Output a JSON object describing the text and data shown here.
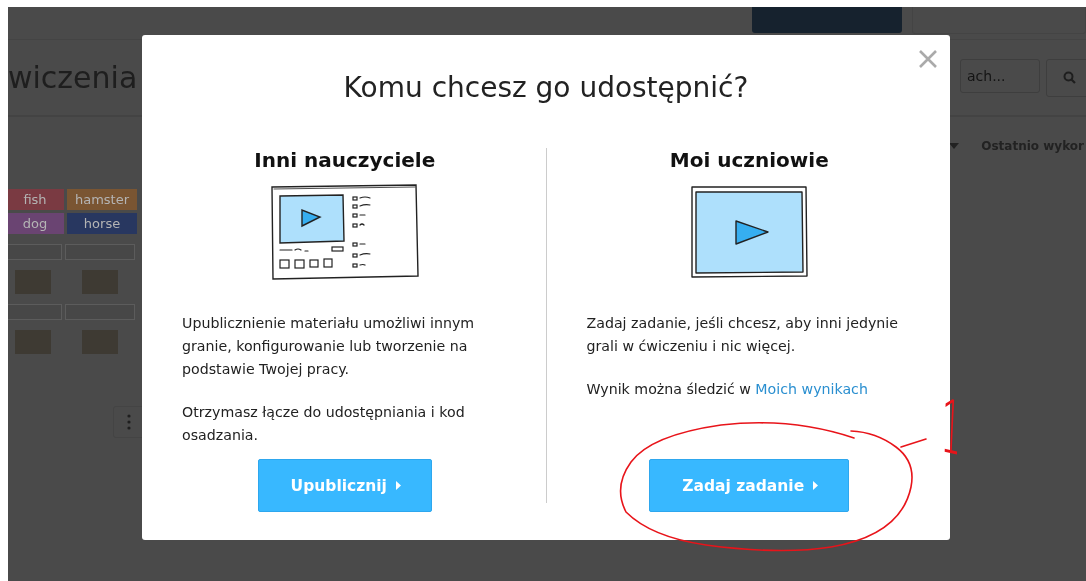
{
  "background": {
    "title": "wiczenia",
    "search": {
      "placeholder": "ach..."
    },
    "sort_label": "Ostatnio wykor",
    "tags": [
      {
        "label": "fish",
        "color": "#7a3a42"
      },
      {
        "label": "hamster",
        "color": "#7a5532"
      },
      {
        "label": "dog",
        "color": "#6a4472"
      },
      {
        "label": "horse",
        "color": "#283760"
      }
    ]
  },
  "dialog": {
    "title": "Komu chcesz go udostępnić?",
    "options": [
      {
        "kind": "publish",
        "heading": "Inni nauczyciele",
        "paragraphs": [
          {
            "text": "Upublicznienie materiału umożliwi innym granie, konfigurowanie lub tworzenie na podstawie Twojej pracy."
          },
          {
            "text": "Otrzymasz łącze do udostępniania i kod osadzania."
          }
        ],
        "button": "Upublicznij"
      },
      {
        "kind": "assign",
        "heading": "Moi uczniowie",
        "paragraphs": [
          {
            "text": "Zadaj zadanie, jeśli chcesz, aby inni jedynie grali w ćwiczeniu i nic więcej."
          },
          {
            "text": "Wynik można śledzić w ",
            "link": "Moich wynikach"
          }
        ],
        "button": "Zadaj zadanie"
      }
    ]
  },
  "annotation": {
    "label": "1"
  }
}
